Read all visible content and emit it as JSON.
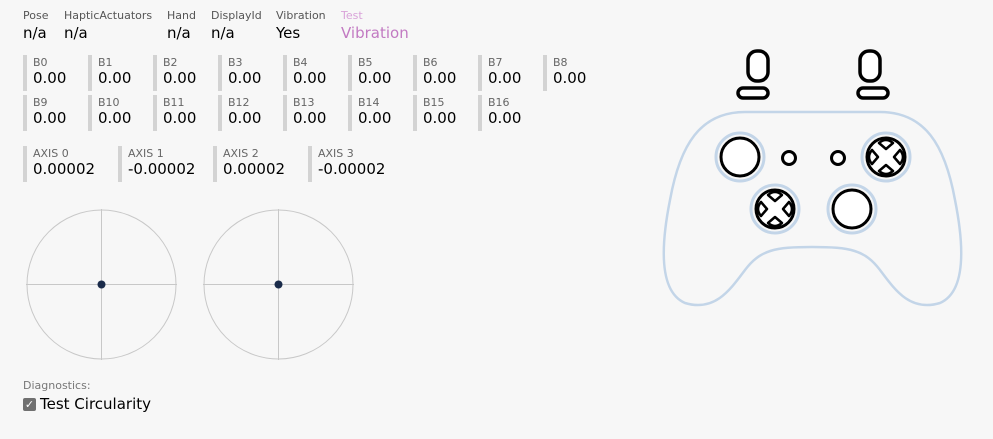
{
  "info": {
    "pose": {
      "key": "Pose",
      "value": "n/a"
    },
    "haptic": {
      "key": "HapticActuators",
      "value": "n/a"
    },
    "hand": {
      "key": "Hand",
      "value": "n/a"
    },
    "display": {
      "key": "DisplayId",
      "value": "n/a"
    },
    "vibration": {
      "key": "Vibration",
      "value": "Yes"
    },
    "test": {
      "key": "Test",
      "value": "Vibration"
    }
  },
  "buttons": [
    {
      "label": "B0",
      "value": "0.00"
    },
    {
      "label": "B1",
      "value": "0.00"
    },
    {
      "label": "B2",
      "value": "0.00"
    },
    {
      "label": "B3",
      "value": "0.00"
    },
    {
      "label": "B4",
      "value": "0.00"
    },
    {
      "label": "B5",
      "value": "0.00"
    },
    {
      "label": "B6",
      "value": "0.00"
    },
    {
      "label": "B7",
      "value": "0.00"
    },
    {
      "label": "B8",
      "value": "0.00"
    },
    {
      "label": "B9",
      "value": "0.00"
    },
    {
      "label": "B10",
      "value": "0.00"
    },
    {
      "label": "B11",
      "value": "0.00"
    },
    {
      "label": "B12",
      "value": "0.00"
    },
    {
      "label": "B13",
      "value": "0.00"
    },
    {
      "label": "B14",
      "value": "0.00"
    },
    {
      "label": "B15",
      "value": "0.00"
    },
    {
      "label": "B16",
      "value": "0.00"
    }
  ],
  "axes": [
    {
      "label": "AXIS 0",
      "value": "0.00002"
    },
    {
      "label": "AXIS 1",
      "value": "-0.00002"
    },
    {
      "label": "AXIS 2",
      "value": "0.00002"
    },
    {
      "label": "AXIS 3",
      "value": "-0.00002"
    }
  ],
  "diagnostics": {
    "label": "Diagnostics:",
    "checkbox_label": "Test Circularity",
    "checked": true
  },
  "colors": {
    "gamepad_outline": "#c3d5e8",
    "stick_dot": "#1a2b4a",
    "plot_line": "#c8c8c8"
  }
}
